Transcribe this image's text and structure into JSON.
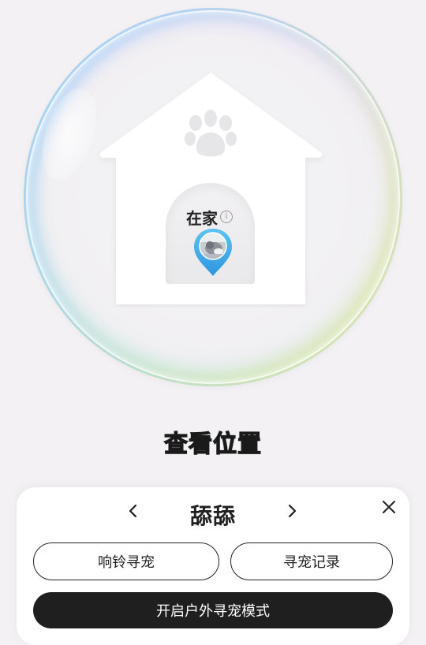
{
  "house": {
    "status_text": "在家",
    "info_icon": "info-icon",
    "paw_icon": "paw-icon"
  },
  "actions": {
    "view_location": "查看位置"
  },
  "pet_card": {
    "pet_name": "舔舔",
    "prev_icon": "chevron-left-icon",
    "next_icon": "chevron-right-icon",
    "close_icon": "close-icon",
    "ring_button": "响铃寻宠",
    "history_button": "寻宠记录",
    "outdoor_mode_button": "开启户外寻宠模式"
  },
  "colors": {
    "pin_blue": "#3aa7e6",
    "pin_light": "#5cc4f2",
    "primary_button": "#1f1f1f",
    "background": "#f3f1f3"
  }
}
